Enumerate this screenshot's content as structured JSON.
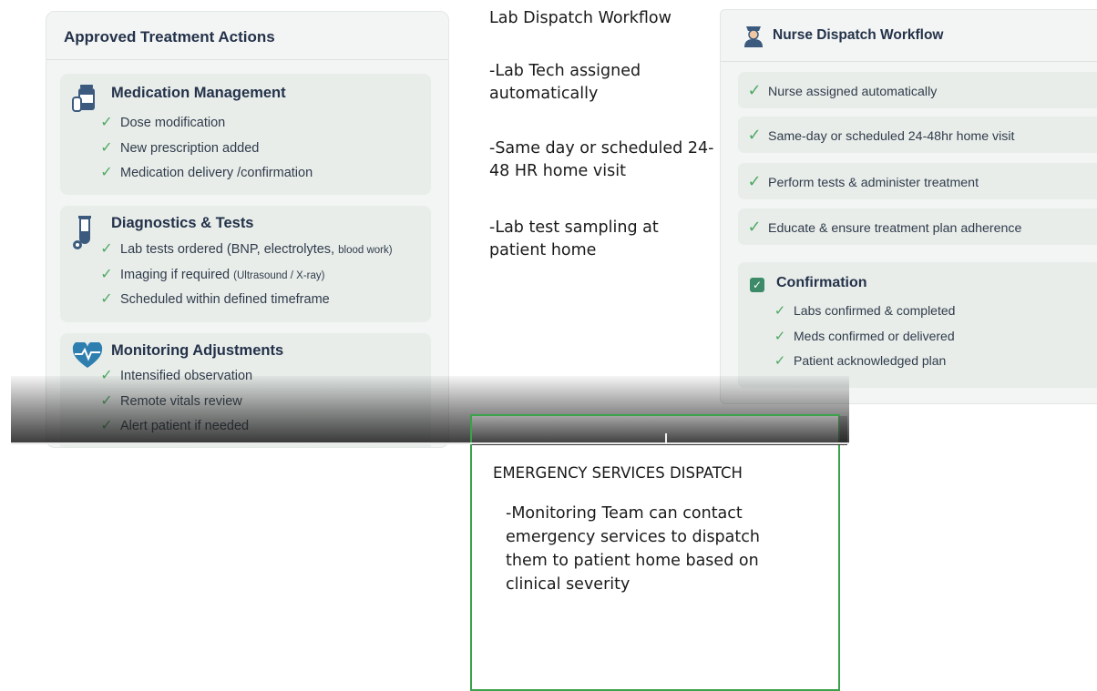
{
  "approved": {
    "title": "Approved Treatment Actions",
    "cards": [
      {
        "icon": "medication-bottles-icon",
        "title": "Medication Management",
        "items": [
          "Dose modification",
          "New prescription added",
          "Medication delivery /confirmation"
        ]
      },
      {
        "icon": "test-tube-icon",
        "title": "Diagnostics & Tests",
        "items": [
          {
            "main": "Lab tests ordered ",
            "paren_a": "(BNP, electrolytes, ",
            "paren_b": "blood work)"
          },
          {
            "main": "Imaging if required ",
            "paren": "(Ultrasound / X-ray)"
          },
          "Scheduled within defined timeframe"
        ]
      },
      {
        "icon": "heart-pulse-icon",
        "title": "Monitoring Adjustments",
        "items": [
          "Intensified observation",
          "Remote vitals review",
          "Alert patient if needed"
        ]
      }
    ]
  },
  "lab": {
    "title": "Lab Dispatch Workflow",
    "items": [
      "-Lab Tech assigned automatically",
      "-Same day or scheduled 24-48 HR home visit",
      "-Lab test sampling at patient home"
    ]
  },
  "nurse": {
    "icon": "nurse-icon",
    "title": "Nurse Dispatch Workflow",
    "steps": [
      "Nurse assigned automatically",
      "Same-day or scheduled 24-48hr home visit",
      "Perform tests & administer treatment",
      "Educate & ensure treatment plan adherence"
    ],
    "confirmation": {
      "title": "Confirmation",
      "items": [
        "Labs confirmed & completed",
        "Meds confirmed or delivered",
        "Patient acknowledged plan"
      ]
    }
  },
  "emergency": {
    "title": "EMERGENCY SERVICES DISPATCH",
    "body": "-Monitoring Team can contact emergency services to dispatch them to patient home based on clinical severity"
  },
  "colors": {
    "check": "#4fa862",
    "card_bg": "#e8edea",
    "panel_bg": "#f3f5f4",
    "emergency_border": "#3aa34a",
    "title_text": "#24324a"
  }
}
